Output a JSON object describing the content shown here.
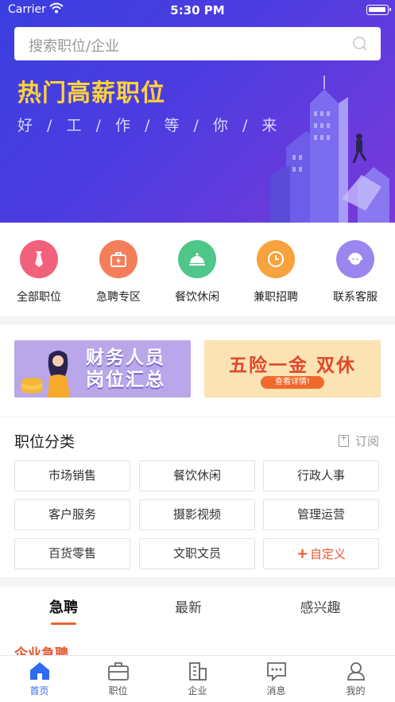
{
  "status_bar": {
    "carrier": "Carrier",
    "time": "5:30 PM"
  },
  "search": {
    "placeholder": "搜索职位/企业"
  },
  "hero": {
    "title": "热门高薪职位",
    "subtitle": "好 / 工 / 作 / 等 / 你 / 来"
  },
  "quick_links": [
    {
      "label": "全部职位",
      "icon": "tie-icon",
      "color": "#f2617a"
    },
    {
      "label": "急聘专区",
      "icon": "urgent-bag-icon",
      "color": "#f47d5a"
    },
    {
      "label": "餐饮休闲",
      "icon": "food-cloche-icon",
      "color": "#4fc78a"
    },
    {
      "label": "兼职招聘",
      "icon": "clock-icon",
      "color": "#f7a23c"
    },
    {
      "label": "联系客服",
      "icon": "customer-service-icon",
      "color": "#9b86f0"
    }
  ],
  "banners": {
    "finance": {
      "line1": "财务人员",
      "line2": "岗位汇总"
    },
    "benefits": {
      "text": "五险一金 双休",
      "button": "查看详情!"
    }
  },
  "categories": {
    "title": "职位分类",
    "subscribe": "订阅",
    "items": [
      "市场销售",
      "餐饮休闲",
      "行政人事",
      "客户服务",
      "摄影视频",
      "管理运营",
      "百货零售",
      "文职文员"
    ],
    "custom": "自定义"
  },
  "tabs": [
    "急聘",
    "最新",
    "感兴趣"
  ],
  "section_title": "企业急聘",
  "bottom_nav": [
    "首页",
    "职位",
    "企业",
    "消息",
    "我的"
  ],
  "colors": {
    "accent": "#2f6bf0",
    "orange": "#f0612f",
    "hero_title": "#ffd43a"
  }
}
